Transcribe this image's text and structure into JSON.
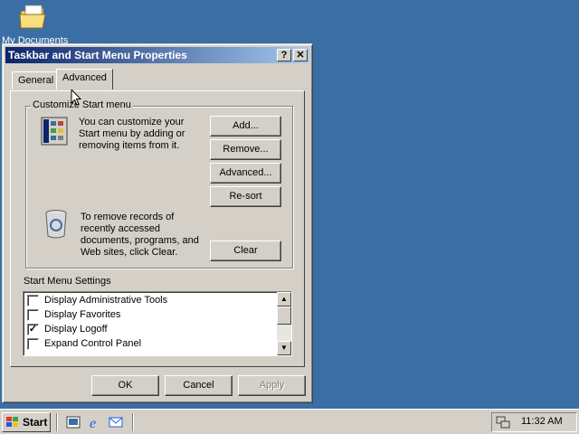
{
  "desktop": {
    "my_documents_label": "My Documents"
  },
  "window": {
    "title": "Taskbar and Start Menu Properties",
    "help_button": "?",
    "close_button": "✕",
    "tabs": [
      {
        "label": "General",
        "active": false
      },
      {
        "label": "Advanced",
        "active": true
      }
    ],
    "customize_group": {
      "title": "Customize Start menu",
      "description": [
        "You can customize your",
        "Start menu by adding or",
        "removing items from it."
      ],
      "buttons": {
        "add": "Add...",
        "remove": "Remove...",
        "advanced": "Advanced...",
        "resort": "Re-sort"
      },
      "clear_description": [
        "To remove records of",
        "recently accessed",
        "documents, programs, and",
        "Web sites,  click Clear."
      ],
      "clear_button": "Clear"
    },
    "settings": {
      "title": "Start Menu Settings",
      "items": [
        {
          "label": "Display Administrative Tools",
          "checked": false
        },
        {
          "label": "Display Favorites",
          "checked": false
        },
        {
          "label": "Display Logoff",
          "checked": true
        },
        {
          "label": "Expand Control Panel",
          "checked": false
        }
      ]
    },
    "footer": {
      "ok": "OK",
      "cancel": "Cancel",
      "apply": "Apply"
    }
  },
  "taskbar": {
    "start_label": "Start",
    "quick_launch": [
      "show-desktop-icon",
      "ie-icon",
      "outlook-icon"
    ],
    "clock": "11:32 AM"
  }
}
